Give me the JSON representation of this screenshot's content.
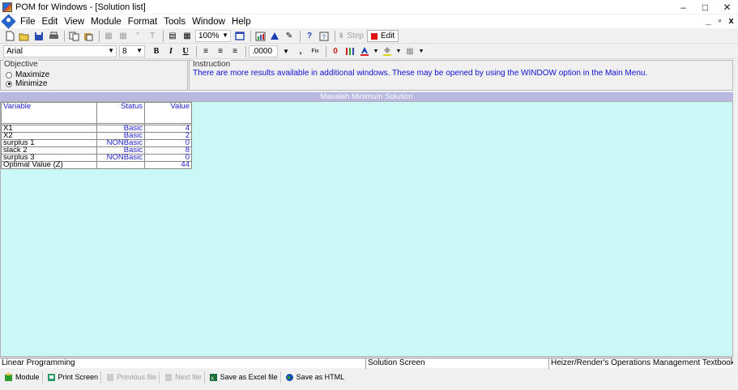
{
  "window": {
    "title": "POM for Windows - [Solution list]",
    "controls": [
      "–",
      "□",
      "✕"
    ]
  },
  "menubar": {
    "items": [
      {
        "label": "File"
      },
      {
        "label": "Edit"
      },
      {
        "label": "View"
      },
      {
        "label": "Module"
      },
      {
        "label": "Format"
      },
      {
        "label": "Tools"
      },
      {
        "label": "Window"
      },
      {
        "label": "Help"
      }
    ],
    "mdi_controls": [
      "_",
      "▫",
      "x"
    ]
  },
  "toolbar1": {
    "zoom": "100%",
    "step_label": "Step",
    "edit_label": "Edit"
  },
  "toolbar2": {
    "font": "Arial",
    "font_size": "8",
    "number_format": ".0000"
  },
  "objective": {
    "label": "Objective",
    "options": [
      {
        "label": "Maximize",
        "selected": false
      },
      {
        "label": "Minimize",
        "selected": true
      }
    ]
  },
  "instruction": {
    "label": "Instruction",
    "text": "There are more results available in additional windows. These may be opened by using the WINDOW option in the Main Menu."
  },
  "solution": {
    "title": "Masalah Minimum Solution",
    "columns": [
      "Variable",
      "Status",
      "Value"
    ],
    "rows": [
      {
        "variable": "X1",
        "status": "Basic",
        "value": "4"
      },
      {
        "variable": "X2",
        "status": "Basic",
        "value": "2"
      },
      {
        "variable": "surplus 1",
        "status": "NONBasic",
        "value": "0"
      },
      {
        "variable": "slack 2",
        "status": "Basic",
        "value": "8"
      },
      {
        "variable": "surplus 3",
        "status": "NONBasic",
        "value": "0"
      },
      {
        "variable": "Optimal Value (Z)",
        "status": "",
        "value": "44"
      }
    ]
  },
  "statusbar": {
    "module": "Linear Programming",
    "screen": "Solution Screen",
    "textbook": "Heizer/Render's Operations Management Textbook"
  },
  "bottombar": {
    "buttons": [
      {
        "label": "Module",
        "enabled": true
      },
      {
        "label": "Print Screen",
        "enabled": true
      },
      {
        "label": "Previous file",
        "enabled": false
      },
      {
        "label": "Next file",
        "enabled": false
      },
      {
        "label": "Save as Excel file",
        "enabled": true
      },
      {
        "label": "Save as HTML",
        "enabled": true
      }
    ]
  },
  "colors": {
    "grid_background": "#ccf7f7",
    "grid_title_bar": "#b8b8e0",
    "value_text": "#2222cc"
  }
}
